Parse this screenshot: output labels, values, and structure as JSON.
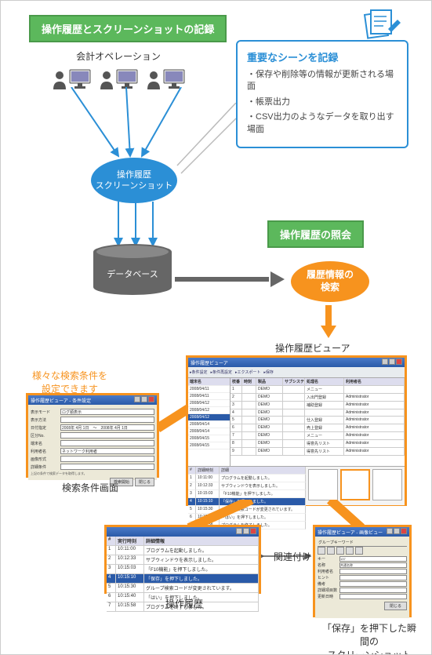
{
  "badges": {
    "recording": "操作履歴とスクリーンショットの記録",
    "inquiry": "操作履歴の照会"
  },
  "accounting_label": "会計オペレーション",
  "blue_ellipse": {
    "l1": "操作履歴",
    "l2": "スクリーンショット"
  },
  "database_label": "データベース",
  "callout": {
    "title": "重要なシーンを記録",
    "items": [
      "保存や削除等の情報が更新される場面",
      "帳票出力",
      "CSV出力のようなデータを取り出す場面"
    ]
  },
  "orange_ellipse": {
    "l1": "履歴情報の",
    "l2": "検索"
  },
  "viewer_label": "操作履歴ビューア",
  "annotations": {
    "search_conditions": "様々な検索条件を\n設定できます",
    "relate": "関連付け"
  },
  "captions": {
    "search_screen": "検索条件画面",
    "history": "操作履歴",
    "screenshot": "「保存」を押下した瞬間の\nスクリーンショット"
  },
  "mock_search": {
    "title": "操作履歴ビューア - 条件設定",
    "fields": [
      {
        "label": "表示モード",
        "value": "ログ順表示"
      },
      {
        "label": "表示方法",
        "value": ""
      },
      {
        "label": "日付指定",
        "value_from": "2008年 4月 1日",
        "value_to": "2008年 4月 1日"
      },
      {
        "label": "区分No.",
        "value": ""
      },
      {
        "label": "端末名",
        "value": ""
      },
      {
        "label": "利用者名",
        "value": "ネットワーク利用者"
      },
      {
        "label": "画像形式",
        "value": ""
      },
      {
        "label": "詳細条件",
        "value": ""
      }
    ],
    "hint": "上記の条件で検索データを取得します。",
    "buttons": [
      "検索開始",
      "閉じる"
    ]
  },
  "mock_viewer": {
    "title": "操作履歴ビューア",
    "toolbar": [
      "条件設定",
      "条件再設定",
      "エクスポート",
      "保存"
    ],
    "side_header": "端末名",
    "side": [
      "2008/04/11",
      "2008/04/11",
      "2008/04/12",
      "2008/04/12",
      "2008/04/12",
      "2008/04/14",
      "2008/04/14",
      "2008/04/15",
      "2008/04/15"
    ],
    "side_selected_index": 4,
    "grid_headers": [
      "枝番",
      "時刻",
      "製品",
      "サブシステム名",
      "処理名",
      "利用者名"
    ],
    "grid_rows": [
      [
        "1",
        "",
        "DEMO",
        "",
        "メニュー",
        ""
      ],
      [
        "2",
        "",
        "DEMO",
        "",
        "入出門登録",
        "Administrator"
      ],
      [
        "3",
        "",
        "DEMO",
        "",
        "補助登録",
        "Administrator"
      ],
      [
        "4",
        "",
        "DEMO",
        "",
        "",
        "Administrator"
      ],
      [
        "5",
        "",
        "DEMO",
        "",
        "仕入登録",
        "Administrator"
      ],
      [
        "6",
        "",
        "DEMO",
        "",
        "売上登録",
        "Administrator"
      ],
      [
        "7",
        "",
        "DEMO",
        "",
        "メニュー",
        "Administrator"
      ],
      [
        "8",
        "",
        "DEMO",
        "",
        "得意先リスト",
        "Administrator"
      ],
      [
        "9",
        "",
        "DEMO",
        "",
        "得意先リスト",
        "Administrator"
      ]
    ],
    "detail_headers": [
      "#",
      "詳細時刻",
      "詳細"
    ],
    "detail_rows": [
      [
        "1",
        "10:11:00",
        "プログラムを起動しました。"
      ],
      [
        "2",
        "10:12:33",
        "サブウィンドウを表示しました。"
      ],
      [
        "3",
        "10:15:03",
        "「F10機能」を押下しました。"
      ],
      [
        "4",
        "10:15:10",
        "「保存」を押下しました。"
      ],
      [
        "5",
        "10:15:30",
        "グループ検索コードが変更されています。"
      ],
      [
        "6",
        "10:15:40",
        "「はい」を押下しました。"
      ],
      [
        "7",
        "10:15:58",
        "プログラムを終了しました。"
      ]
    ],
    "detail_selected_index": 3
  },
  "mock_history": {
    "headers": [
      "#",
      "実行時刻",
      "詳細情報"
    ],
    "rows": [
      [
        "1",
        "10:11:00",
        "プログラムを起動しました。"
      ],
      [
        "2",
        "10:12:33",
        "サブウィンドウを表示しました。"
      ],
      [
        "3",
        "10:15:03",
        "「F10機能」を押下しました。"
      ],
      [
        "4",
        "10:15:10",
        "「保存」を押下しました。"
      ],
      [
        "5",
        "10:15:30",
        "グループ検索コードが変更されています。"
      ],
      [
        "6",
        "10:15:40",
        "「はい」を押下しました。"
      ],
      [
        "7",
        "10:15:58",
        "プログラムを終了しました。"
      ]
    ],
    "selected_index": 3
  },
  "mock_shot": {
    "title": "操作履歴ビューア - 画像ビュー",
    "tab": "グループキーワード",
    "fields": [
      {
        "label": "キー",
        "value": "137"
      },
      {
        "label": "名称",
        "value": "共通名称"
      },
      {
        "label": "利用者名",
        "value": ""
      },
      {
        "label": "ヒント",
        "value": ""
      },
      {
        "label": "備考",
        "value": ""
      },
      {
        "label": "詳細項目数",
        "value": ""
      },
      {
        "label": "更新日時",
        "value": ""
      }
    ],
    "button": "閉じる"
  }
}
